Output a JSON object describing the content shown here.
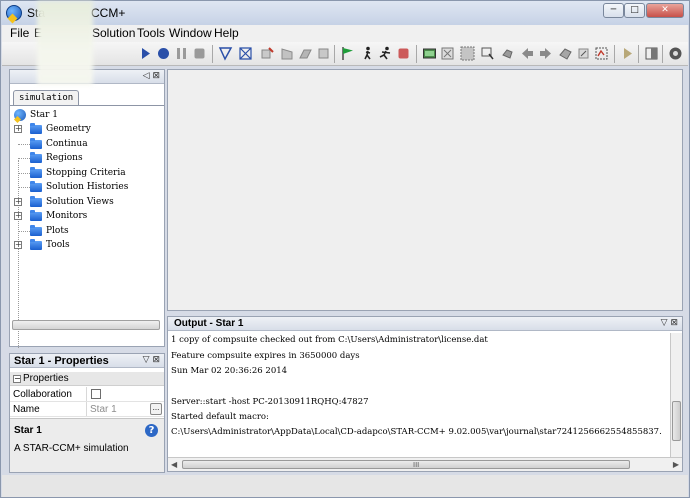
{
  "window": {
    "title_visible": "Sta",
    "title_suffix": "CCM+",
    "min_label": "─",
    "max_label": "□",
    "close_label": "✕"
  },
  "menu": {
    "items": [
      {
        "label": "File"
      },
      {
        "label": "E"
      },
      {
        "label": "Solution"
      },
      {
        "label": "Tools"
      },
      {
        "label": "Window"
      },
      {
        "label": "Help"
      }
    ]
  },
  "toolbar": {
    "icons": [
      "run-icon",
      "record-icon",
      "pause-icon",
      "stop-icon",
      "step-icon",
      "mesh-icon",
      "mesh-repair-icon",
      "surface-icon",
      "volume-icon",
      "flag-icon",
      "walk-icon",
      "run-person-icon",
      "stop-record-icon",
      "screenshot-icon",
      "view-fit-icon",
      "grid-icon",
      "select-icon",
      "rotate-icon",
      "back-icon",
      "forward-icon",
      "reset-view-icon",
      "light-icon",
      "render-icon",
      "play-icon",
      "panel-icon",
      "settings-icon"
    ]
  },
  "simulation_panel": {
    "tab_label": "simulation",
    "root": "Star 1",
    "items": [
      {
        "label": "Geometry",
        "expandable": true
      },
      {
        "label": "Continua",
        "expandable": false
      },
      {
        "label": "Regions",
        "expandable": false
      },
      {
        "label": "Stopping Criteria",
        "expandable": false
      },
      {
        "label": "Solution Histories",
        "expandable": false
      },
      {
        "label": "Solution Views",
        "expandable": true
      },
      {
        "label": "Monitors",
        "expandable": true
      },
      {
        "label": "Plots",
        "expandable": false
      },
      {
        "label": "Tools",
        "expandable": true
      }
    ]
  },
  "properties_panel": {
    "title": "Star 1 - Properties",
    "section": "Properties",
    "rows": [
      {
        "key": "Collaboration",
        "value": ""
      },
      {
        "key": "Name",
        "value": "Star 1"
      }
    ],
    "description_title": "Star 1",
    "description_text": "A STAR-CCM+ simulation"
  },
  "output_panel": {
    "title": "Output - Star 1",
    "lines": [
      "1 copy of compsuite checked out from C:\\Users\\Administrator\\license.dat",
      "Feature compsuite expires in 3650000 days",
      "Sun Mar 02 20:36:26 2014",
      "",
      "Server::start -host PC-20130911RQHQ:47827",
      "Started default macro:",
      "C:\\Users\\Administrator\\AppData\\Local\\CD-adapco\\STAR-CCM+ 9.02.005\\var\\journal\\star7241256662554855837."
    ]
  }
}
